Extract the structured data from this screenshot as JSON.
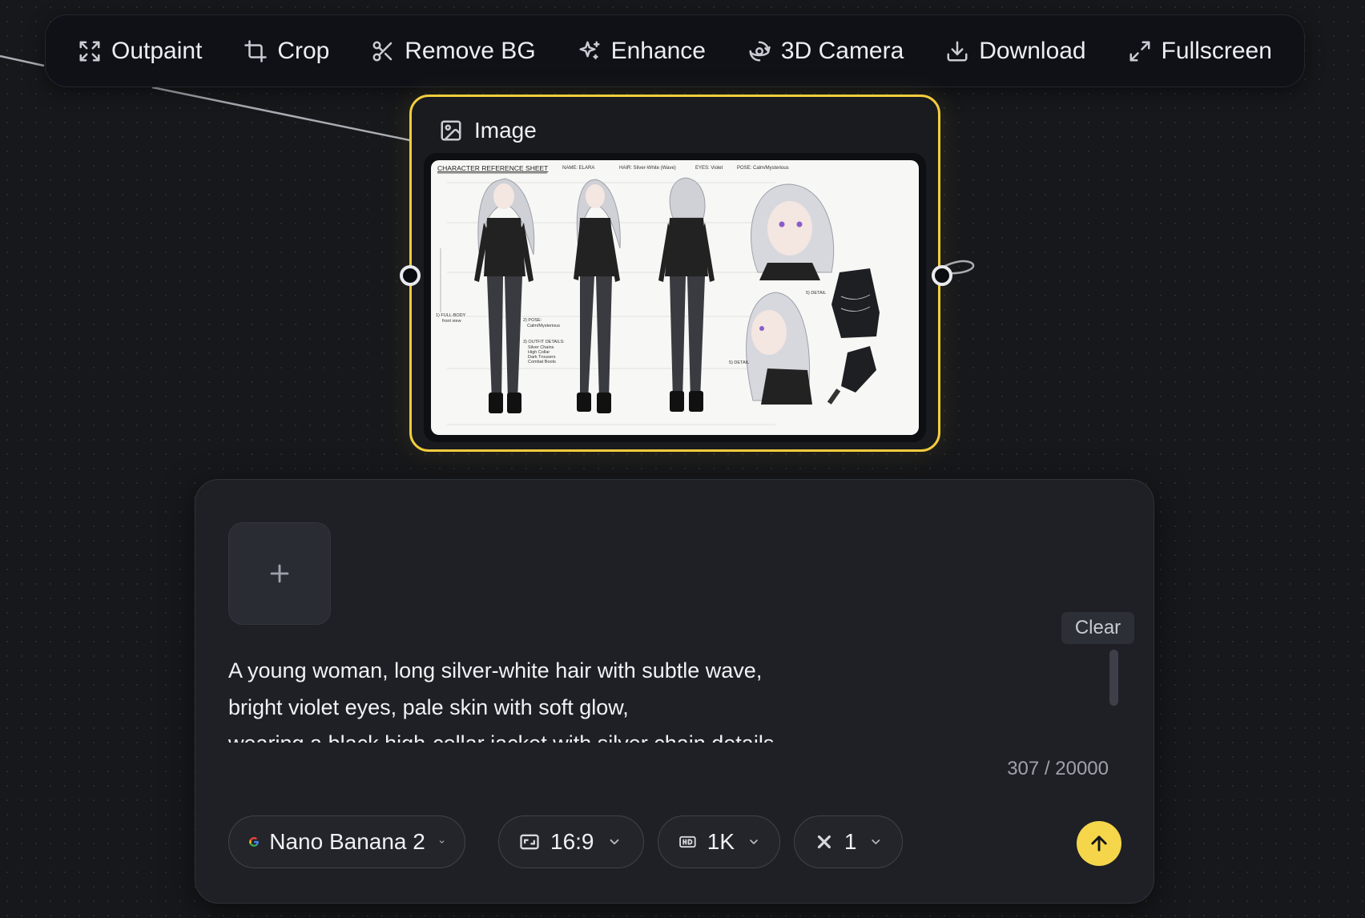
{
  "toolbar": {
    "items": [
      {
        "label": "Outpaint",
        "icon": "expand-corners-icon"
      },
      {
        "label": "Crop",
        "icon": "crop-icon"
      },
      {
        "label": "Remove BG",
        "icon": "scissors-icon"
      },
      {
        "label": "Enhance",
        "icon": "sparkles-icon"
      },
      {
        "label": "3D Camera",
        "icon": "3d-rotate-icon"
      },
      {
        "label": "Download",
        "icon": "download-icon"
      },
      {
        "label": "Fullscreen",
        "icon": "maximize-icon"
      }
    ]
  },
  "node": {
    "title": "Image",
    "icon": "image-icon",
    "accent": "#f2cd3d",
    "image": {
      "header": "CHARACTER REFERENCE SHEET",
      "fields": [
        "NAME: ELARA",
        "HAIR: Silver-White (Wave)",
        "EYES: Violet",
        "POSE: Calm/Mysterious"
      ],
      "notes": [
        "1) FULL-BODY\nfront view",
        "2) POSE:\nCalm/Mysterious",
        "3) OUTFIT DETAILS:\nSilver Chains\nHigh Collar\nDark Trousers\nCombat Boots",
        "5) DETAIL",
        "5) DETAIL"
      ]
    }
  },
  "prompt_panel": {
    "add_icon": "plus-icon",
    "clear_label": "Clear",
    "prompt_text": "A young woman, long silver-white hair with subtle wave,\nbright violet eyes, pale skin with soft glow,\nwearing a black high-collar jacket with silver chain details,\nslender build, calm and mysterious expression",
    "char_count": "307 / 20000",
    "model": {
      "label": "Nano Banana 2",
      "icon": "google-icon"
    },
    "aspect": {
      "label": "16:9",
      "icon": "aspect-ratio-icon"
    },
    "quality": {
      "label": "1K",
      "icon": "hd-icon"
    },
    "count": {
      "label": "1",
      "icon": "multiply-icon"
    },
    "send_icon": "arrow-up-icon",
    "send_color": "#f5d64a"
  }
}
